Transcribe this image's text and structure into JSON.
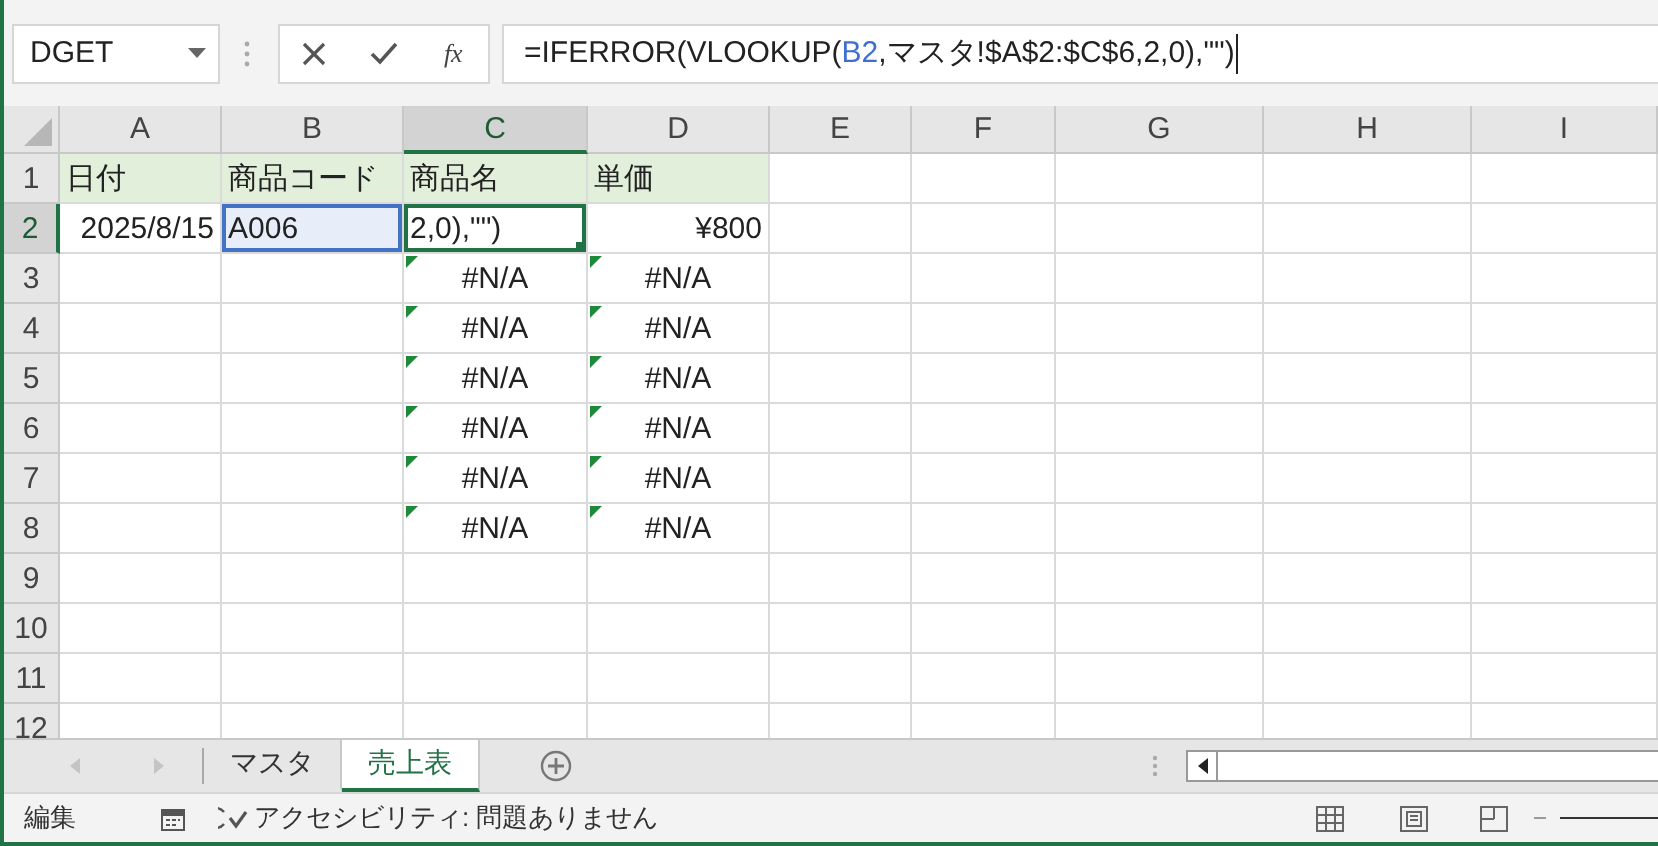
{
  "name_box": {
    "value": "DGET"
  },
  "formula_bar": {
    "function_label": "fx",
    "parts": [
      {
        "text": "=IFERROR(VLOOKUP(",
        "kind": "plain"
      },
      {
        "text": "B2",
        "kind": "ref"
      },
      {
        "text": ",マスタ!$A$2:$C$6,2,0),\"\")",
        "kind": "plain"
      }
    ]
  },
  "columns": [
    {
      "label": "A",
      "selected": false
    },
    {
      "label": "B",
      "selected": false
    },
    {
      "label": "C",
      "selected": true
    },
    {
      "label": "D",
      "selected": false
    },
    {
      "label": "E",
      "selected": false
    },
    {
      "label": "F",
      "selected": false
    },
    {
      "label": "G",
      "selected": false
    },
    {
      "label": "H",
      "selected": false
    },
    {
      "label": "I",
      "selected": false
    }
  ],
  "rows": [
    {
      "number": "1",
      "selected": false,
      "cells": [
        {
          "kind": "header",
          "text": "日付"
        },
        {
          "kind": "header",
          "text": "商品コード"
        },
        {
          "kind": "header",
          "text": "商品名"
        },
        {
          "kind": "header",
          "text": "単価"
        }
      ]
    },
    {
      "number": "2",
      "selected": true,
      "cells": [
        {
          "kind": "number",
          "text": "2025/8/15"
        },
        {
          "kind": "reference",
          "text": "A006"
        },
        {
          "kind": "editing",
          "text": "2,0),\"\")"
        },
        {
          "kind": "number",
          "text": "¥800"
        }
      ]
    },
    {
      "number": "3",
      "selected": false,
      "cells": [
        {
          "kind": "empty"
        },
        {
          "kind": "empty"
        },
        {
          "kind": "error",
          "text": "#N/A"
        },
        {
          "kind": "error",
          "text": "#N/A"
        }
      ]
    },
    {
      "number": "4",
      "selected": false,
      "cells": [
        {
          "kind": "empty"
        },
        {
          "kind": "empty"
        },
        {
          "kind": "error",
          "text": "#N/A"
        },
        {
          "kind": "error",
          "text": "#N/A"
        }
      ]
    },
    {
      "number": "5",
      "selected": false,
      "cells": [
        {
          "kind": "empty"
        },
        {
          "kind": "empty"
        },
        {
          "kind": "error",
          "text": "#N/A"
        },
        {
          "kind": "error",
          "text": "#N/A"
        }
      ]
    },
    {
      "number": "6",
      "selected": false,
      "cells": [
        {
          "kind": "empty"
        },
        {
          "kind": "empty"
        },
        {
          "kind": "error",
          "text": "#N/A"
        },
        {
          "kind": "error",
          "text": "#N/A"
        }
      ]
    },
    {
      "number": "7",
      "selected": false,
      "cells": [
        {
          "kind": "empty"
        },
        {
          "kind": "empty"
        },
        {
          "kind": "error",
          "text": "#N/A"
        },
        {
          "kind": "error",
          "text": "#N/A"
        }
      ]
    },
    {
      "number": "8",
      "selected": false,
      "cells": [
        {
          "kind": "empty"
        },
        {
          "kind": "empty"
        },
        {
          "kind": "error",
          "text": "#N/A"
        },
        {
          "kind": "error",
          "text": "#N/A"
        }
      ]
    },
    {
      "number": "9",
      "selected": false,
      "cells": []
    },
    {
      "number": "10",
      "selected": false,
      "cells": []
    },
    {
      "number": "11",
      "selected": false,
      "cells": []
    },
    {
      "number": "12",
      "selected": false,
      "cells": []
    }
  ],
  "sheet_tabs": [
    {
      "label": "マスタ",
      "selected": false
    },
    {
      "label": "売上表",
      "selected": true
    }
  ],
  "status_bar": {
    "mode": "編集",
    "accessibility": "アクセシビリティ: 問題ありません"
  }
}
